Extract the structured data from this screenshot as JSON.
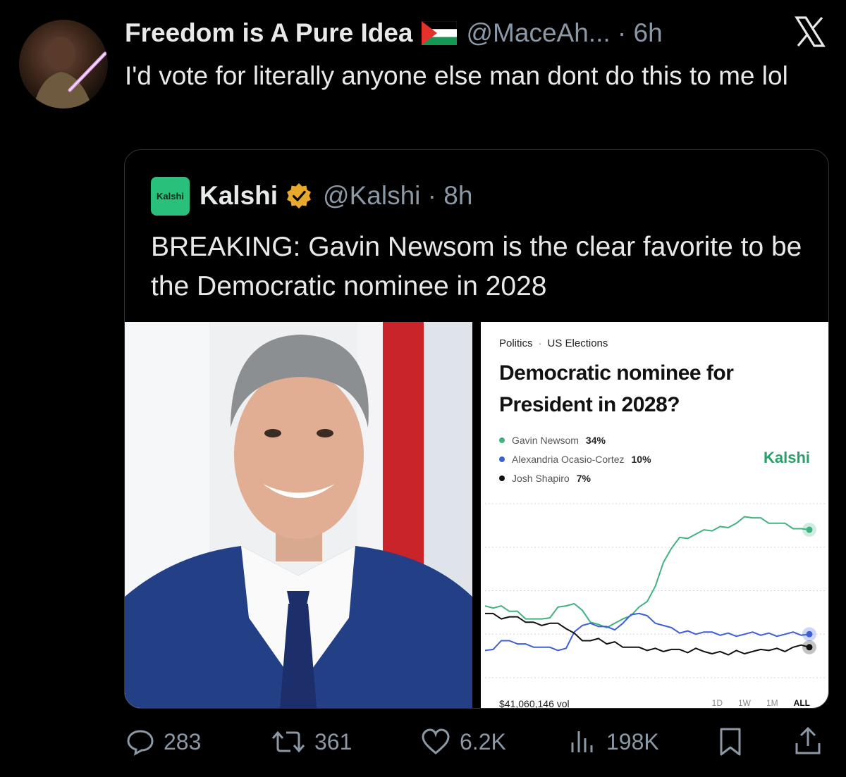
{
  "tweet": {
    "author_name": "Freedom is A Pure Idea",
    "author_handle_time": "@MaceAh... · 6h",
    "text": "I'd vote for literally anyone else man dont do this to me lol"
  },
  "quote": {
    "logo_text": "Kalshi",
    "name": "Kalshi",
    "handle_time": "@Kalshi · 8h",
    "text": "BREAKING: Gavin Newsom is the clear favorite to be the Democratic nominee in 2028",
    "card": {
      "breadcrumb_1": "Politics",
      "breadcrumb_sep": "·",
      "breadcrumb_2": "US Elections",
      "title": "Democratic nominee for President in 2028?",
      "brand": "Kalshi",
      "volume": "$41,060,146 vol",
      "ranges": [
        "1D",
        "1W",
        "1M",
        "ALL"
      ]
    }
  },
  "chart_data": {
    "type": "line",
    "title": "Democratic nominee for President in 2028?",
    "xlabel": "",
    "ylabel": "",
    "grid": true,
    "legend_placement": "top-left",
    "x": [
      0,
      1,
      2,
      3,
      4,
      5,
      6,
      7,
      8,
      9,
      10,
      11,
      12,
      13,
      14,
      15,
      16,
      17,
      18,
      19,
      20,
      21,
      22,
      23,
      24,
      25,
      26,
      27,
      28,
      29,
      30,
      31,
      32,
      33,
      34,
      35,
      36,
      37,
      38,
      39,
      40
    ],
    "series": [
      {
        "name": "Gavin Newsom",
        "label": "34%",
        "color": "#3fb27f",
        "values": [
          17,
          16,
          16,
          15.5,
          15,
          14,
          13.5,
          13,
          14,
          16,
          17,
          17,
          15,
          13,
          12,
          12,
          12.5,
          13,
          14.5,
          16,
          18,
          21,
          26,
          30,
          32,
          32.5,
          33,
          33.5,
          34,
          34.5,
          35,
          35.5,
          36.5,
          37,
          36.5,
          36,
          35.5,
          35,
          34.5,
          34,
          34
        ]
      },
      {
        "name": "Alexandria Ocasio-Cortez",
        "label": "10%",
        "color": "#3d5fd6",
        "values": [
          6,
          7,
          8.5,
          8,
          8,
          7.5,
          7.5,
          7,
          6.5,
          6.5,
          6.5,
          11,
          12,
          12,
          12,
          11.5,
          11.5,
          12.5,
          14,
          15,
          14,
          13,
          12,
          11,
          10.5,
          10.5,
          10.5,
          10.5,
          10,
          10,
          10,
          10,
          10,
          10,
          10,
          10,
          10,
          10,
          10,
          10,
          10
        ]
      },
      {
        "name": "Josh Shapiro",
        "label": "7%",
        "color": "#111111",
        "values": [
          15,
          14.5,
          14,
          14,
          13.5,
          13,
          12.5,
          12.5,
          12.5,
          12,
          11.5,
          10,
          9,
          8.5,
          8.5,
          8,
          8,
          7.5,
          7,
          6.5,
          6.5,
          6.5,
          6.5,
          6.5,
          6,
          6,
          6.5,
          6.5,
          5.5,
          5.5,
          5.5,
          6,
          6,
          6,
          6,
          6.5,
          6.5,
          6.5,
          7,
          7,
          7
        ]
      }
    ]
  },
  "actions": {
    "replies": "283",
    "reposts": "361",
    "likes": "6.2K",
    "views": "198K"
  },
  "icons": {
    "reply": "reply-icon",
    "repost": "repost-icon",
    "like": "heart-icon",
    "views": "views-icon",
    "bookmark": "bookmark-icon",
    "share": "share-icon",
    "x_logo": "x-logo-icon",
    "verified": "verified-badge-icon"
  }
}
